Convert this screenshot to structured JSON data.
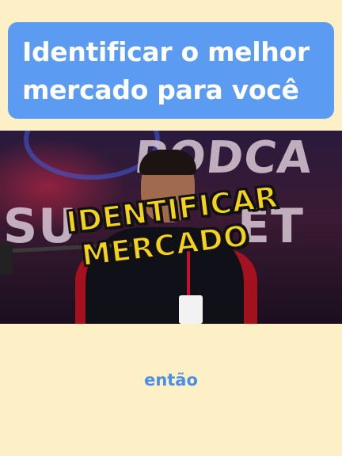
{
  "title_card": {
    "line1": "Identificar o melhor",
    "line2": "mercado para você"
  },
  "video": {
    "background_words": [
      "PODCA",
      "SU",
      "ET"
    ],
    "caption_line1": "IDENTIFICAR",
    "caption_line2": "MERCADO"
  },
  "subtitle": "então",
  "colors": {
    "page_background": "#fdf0c6",
    "title_card": "#5b9cf2",
    "caption_fill": "#f6d21a",
    "subtitle": "#4a8ee6"
  }
}
